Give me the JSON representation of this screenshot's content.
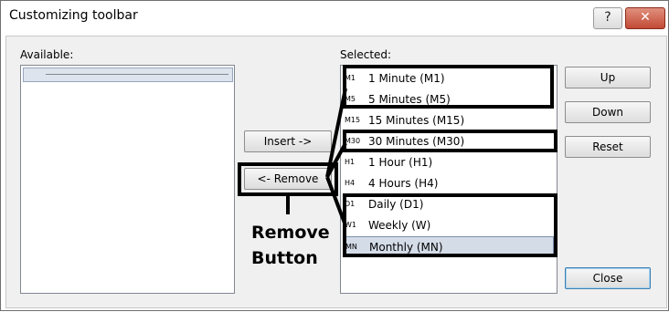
{
  "window": {
    "title": "Customizing toolbar",
    "help_button": "?",
    "close_button": "✕"
  },
  "available": {
    "label": "Available:"
  },
  "selected": {
    "label": "Selected:",
    "items": [
      {
        "code": "M1",
        "label": "1 Minute (M1)"
      },
      {
        "code": "M5",
        "label": "5 Minutes (M5)"
      },
      {
        "code": "M15",
        "label": "15 Minutes (M15)"
      },
      {
        "code": "M30",
        "label": "30 Minutes (M30)"
      },
      {
        "code": "H1",
        "label": "1 Hour (H1)"
      },
      {
        "code": "H4",
        "label": "4 Hours (H4)"
      },
      {
        "code": "D1",
        "label": "Daily (D1)"
      },
      {
        "code": "W1",
        "label": "Weekly (W)"
      },
      {
        "code": "MN",
        "label": "Monthly (MN)"
      }
    ],
    "selected_item": "Monthly (MN)"
  },
  "buttons": {
    "insert": "Insert ->",
    "remove": "<- Remove",
    "up": "Up",
    "down": "Down",
    "reset": "Reset",
    "close": "Close"
  },
  "annotation": {
    "line1": "Remove",
    "line2": "Button"
  }
}
